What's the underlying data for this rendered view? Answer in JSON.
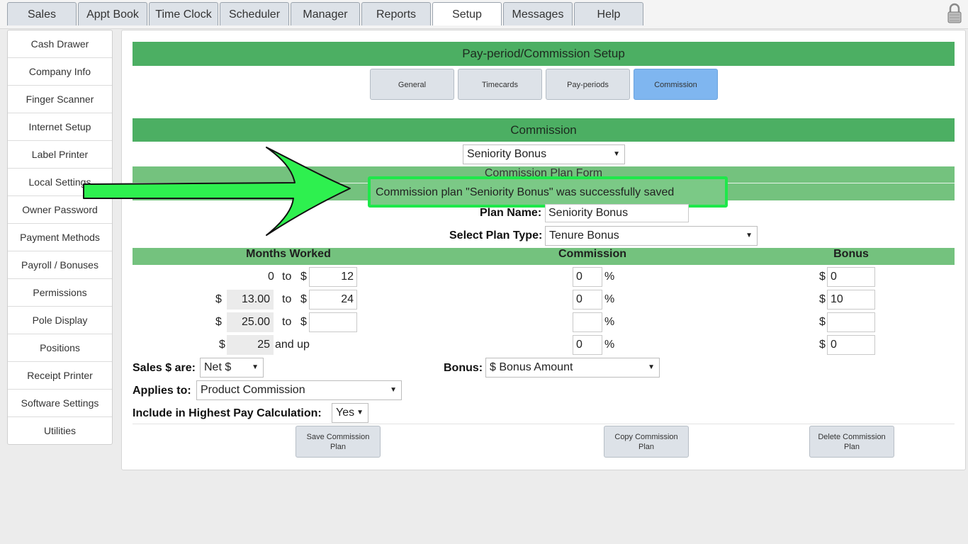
{
  "top_tabs": [
    "Sales",
    "Appt Book",
    "Time Clock",
    "Scheduler",
    "Manager",
    "Reports",
    "Setup",
    "Messages",
    "Help"
  ],
  "active_tab": "Setup",
  "sidebar": {
    "items": [
      "Cash Drawer",
      "Company Info",
      "Finger Scanner",
      "Internet Setup",
      "Label Printer",
      "Local Settings",
      "Owner Password",
      "Payment Methods",
      "Payroll / Bonuses",
      "Permissions",
      "Pole Display",
      "Positions",
      "Receipt Printer",
      "Software Settings",
      "Utilities"
    ]
  },
  "header": {
    "title": "Pay-period/Commission Setup"
  },
  "subtabs": [
    "General",
    "Timecards",
    "Pay-periods",
    "Commission"
  ],
  "active_subtab": "Commission",
  "commission": {
    "section_title": "Commission",
    "plan_select": "Seniority Bonus",
    "form_title": "Commission Plan Form",
    "success_message": "Commission plan \"Seniority Bonus\" was successfully saved",
    "plan_name_label": "Plan Name:",
    "plan_name_value": "Seniority Bonus",
    "plan_type_label": "Select Plan Type:",
    "plan_type_value": "Tenure Bonus"
  },
  "table": {
    "headers": [
      "Months Worked",
      "Commission",
      "Bonus"
    ],
    "to": "to",
    "and_up": "and up",
    "dollar": "$",
    "percent": "%",
    "rows": [
      {
        "from": "0",
        "to": "12",
        "commission": "0",
        "bonus": "0"
      },
      {
        "from": "13.00",
        "to": "24",
        "commission": "0",
        "bonus": "10"
      },
      {
        "from": "25.00",
        "to": "",
        "commission": "",
        "bonus": ""
      },
      {
        "from": "25",
        "commission": "0",
        "bonus": "0"
      }
    ]
  },
  "options": {
    "sales_label": "Sales $ are:",
    "sales_value": "Net $",
    "bonus_label": "Bonus:",
    "bonus_value": "$ Bonus Amount",
    "applies_label": "Applies to:",
    "applies_value": "Product Commission",
    "highest_label": "Include in Highest Pay Calculation:",
    "highest_value": "Yes"
  },
  "buttons": {
    "save": "Save Commission Plan",
    "copy": "Copy Commission Plan",
    "delete": "Delete Commission Plan"
  },
  "colors": {
    "header_green": "#4caf63",
    "light_green": "#74c27e",
    "highlight_green": "#1ee84a",
    "active_subtab": "#7fb6f0"
  }
}
